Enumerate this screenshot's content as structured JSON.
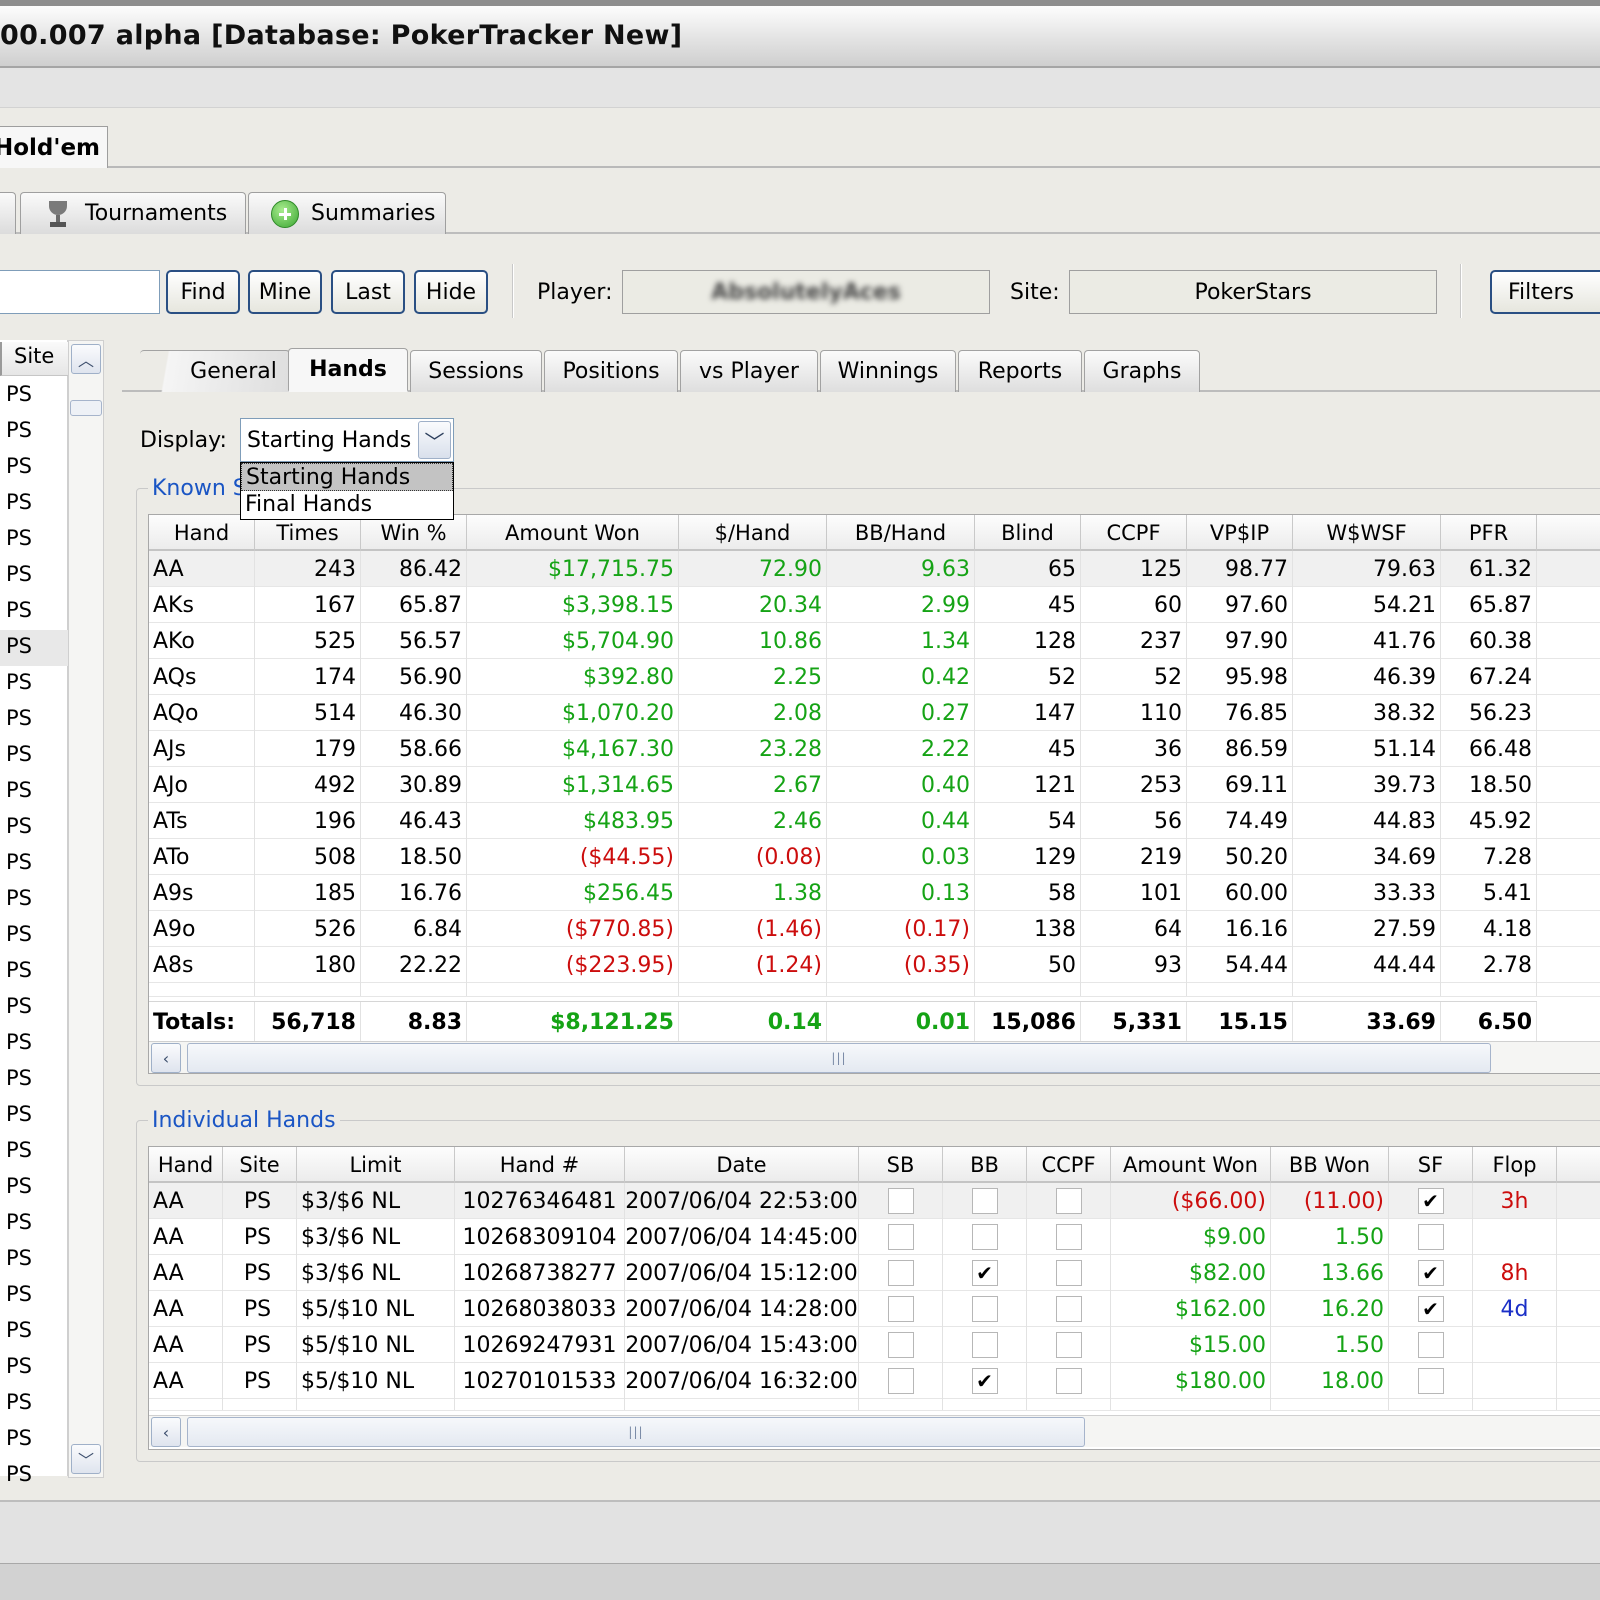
{
  "window": {
    "title": "00.007 alpha [Database: PokerTracker New]"
  },
  "top_tab": {
    "label": "Hold'em"
  },
  "sub_tabs": [
    {
      "label": "Tournaments",
      "icon": "trophy-icon"
    },
    {
      "label": "Summaries",
      "icon": "plus-circle-icon"
    }
  ],
  "toolbar": {
    "search_value": "",
    "find": "Find",
    "mine": "Mine",
    "last": "Last",
    "hide": "Hide",
    "player_label": "Player:",
    "player_value": "AbsolutelyAces",
    "site_label": "Site:",
    "site_value": "PokerStars",
    "filters": "Filters"
  },
  "left_list": {
    "header": "Site",
    "items": [
      "PS",
      "PS",
      "PS",
      "PS",
      "PS",
      "PS",
      "PS",
      "PS",
      "PS",
      "PS",
      "PS",
      "PS",
      "PS",
      "PS",
      "PS",
      "PS",
      "PS",
      "PS",
      "PS",
      "PS",
      "PS",
      "PS",
      "PS",
      "PS",
      "PS",
      "PS",
      "PS",
      "PS",
      "PS",
      "PS",
      "PS"
    ],
    "selected_index": 7
  },
  "inner_tabs": [
    "General",
    "Hands",
    "Sessions",
    "Positions",
    "vs Player",
    "Winnings",
    "Reports",
    "Graphs"
  ],
  "active_inner_tab": "Hands",
  "display": {
    "label": "Display:",
    "value": "Starting Hands",
    "options": [
      "Starting Hands",
      "Final Hands"
    ]
  },
  "known_group": {
    "title": "Known S"
  },
  "known_table": {
    "columns": [
      "Hand",
      "Times",
      "Win %",
      "Amount Won",
      "$/Hand",
      "BB/Hand",
      "Blind",
      "CCPF",
      "VP$IP",
      "W$WSF",
      "PFR"
    ],
    "rows": [
      [
        "AA",
        "243",
        "86.42",
        "$17,715.75",
        "72.90",
        "9.63",
        "65",
        "125",
        "98.77",
        "79.63",
        "61.32"
      ],
      [
        "AKs",
        "167",
        "65.87",
        "$3,398.15",
        "20.34",
        "2.99",
        "45",
        "60",
        "97.60",
        "54.21",
        "65.87"
      ],
      [
        "AKo",
        "525",
        "56.57",
        "$5,704.90",
        "10.86",
        "1.34",
        "128",
        "237",
        "97.90",
        "41.76",
        "60.38"
      ],
      [
        "AQs",
        "174",
        "56.90",
        "$392.80",
        "2.25",
        "0.42",
        "52",
        "52",
        "95.98",
        "46.39",
        "67.24"
      ],
      [
        "AQo",
        "514",
        "46.30",
        "$1,070.20",
        "2.08",
        "0.27",
        "147",
        "110",
        "76.85",
        "38.32",
        "56.23"
      ],
      [
        "AJs",
        "179",
        "58.66",
        "$4,167.30",
        "23.28",
        "2.22",
        "45",
        "36",
        "86.59",
        "51.14",
        "66.48"
      ],
      [
        "AJo",
        "492",
        "30.89",
        "$1,314.65",
        "2.67",
        "0.40",
        "121",
        "253",
        "69.11",
        "39.73",
        "18.50"
      ],
      [
        "ATs",
        "196",
        "46.43",
        "$483.95",
        "2.46",
        "0.44",
        "54",
        "56",
        "74.49",
        "44.83",
        "45.92"
      ],
      [
        "ATo",
        "508",
        "18.50",
        "($44.55)",
        "(0.08)",
        "0.03",
        "129",
        "219",
        "50.20",
        "34.69",
        "7.28"
      ],
      [
        "A9s",
        "185",
        "16.76",
        "$256.45",
        "1.38",
        "0.13",
        "58",
        "101",
        "60.00",
        "33.33",
        "5.41"
      ],
      [
        "A9o",
        "526",
        "6.84",
        "($770.85)",
        "(1.46)",
        "(0.17)",
        "138",
        "64",
        "16.16",
        "27.59",
        "4.18"
      ],
      [
        "A8s",
        "180",
        "22.22",
        "($223.95)",
        "(1.24)",
        "(0.35)",
        "50",
        "93",
        "54.44",
        "44.44",
        "2.78"
      ]
    ],
    "totals": [
      "Totals:",
      "56,718",
      "8.83",
      "$8,121.25",
      "0.14",
      "0.01",
      "15,086",
      "5,331",
      "15.15",
      "33.69",
      "6.50"
    ]
  },
  "individual_group": {
    "title": "Individual Hands"
  },
  "individual_table": {
    "columns": [
      "Hand",
      "Site",
      "Limit",
      "Hand #",
      "Date",
      "SB",
      "BB",
      "CCPF",
      "Amount Won",
      "BB Won",
      "SF",
      "Flop"
    ],
    "rows": [
      {
        "hand": "AA",
        "site": "PS",
        "limit": "$3/$6 NL",
        "number": "10276346481",
        "date": "2007/06/04 22:53:00",
        "sb": false,
        "bb": false,
        "ccpf": false,
        "amount": "($66.00)",
        "bbwon": "(11.00)",
        "sf": true,
        "flop": "3h"
      },
      {
        "hand": "AA",
        "site": "PS",
        "limit": "$3/$6 NL",
        "number": "10268309104",
        "date": "2007/06/04 14:45:00",
        "sb": false,
        "bb": false,
        "ccpf": false,
        "amount": "$9.00",
        "bbwon": "1.50",
        "sf": false,
        "flop": ""
      },
      {
        "hand": "AA",
        "site": "PS",
        "limit": "$3/$6 NL",
        "number": "10268738277",
        "date": "2007/06/04 15:12:00",
        "sb": false,
        "bb": true,
        "ccpf": false,
        "amount": "$82.00",
        "bbwon": "13.66",
        "sf": true,
        "flop": "8h"
      },
      {
        "hand": "AA",
        "site": "PS",
        "limit": "$5/$10 NL",
        "number": "10268038033",
        "date": "2007/06/04 14:28:00",
        "sb": false,
        "bb": false,
        "ccpf": false,
        "amount": "$162.00",
        "bbwon": "16.20",
        "sf": true,
        "flop": "4d"
      },
      {
        "hand": "AA",
        "site": "PS",
        "limit": "$5/$10 NL",
        "number": "10269247931",
        "date": "2007/06/04 15:43:00",
        "sb": false,
        "bb": false,
        "ccpf": false,
        "amount": "$15.00",
        "bbwon": "1.50",
        "sf": false,
        "flop": ""
      },
      {
        "hand": "AA",
        "site": "PS",
        "limit": "$5/$10 NL",
        "number": "10270101533",
        "date": "2007/06/04 16:32:00",
        "sb": false,
        "bb": true,
        "ccpf": false,
        "amount": "$180.00",
        "bbwon": "18.00",
        "sf": false,
        "flop": ""
      }
    ]
  },
  "colors": {
    "positive": "#15a315",
    "negative": "#cc0d0d",
    "group_title": "#1a55c4",
    "flop_diamond": "#1a2fc7"
  },
  "icons": {
    "scroll_left": "chevron-left-icon",
    "scroll_up": "chevron-up-icon",
    "scroll_down": "chevron-down-icon",
    "dropdown": "chevron-down-icon",
    "grip": "scroll-grip-icon"
  },
  "scroll_grip": "|||",
  "glyphs": {
    "left": "‹",
    "up": "︿",
    "down": "﹀",
    "check": "✔"
  }
}
